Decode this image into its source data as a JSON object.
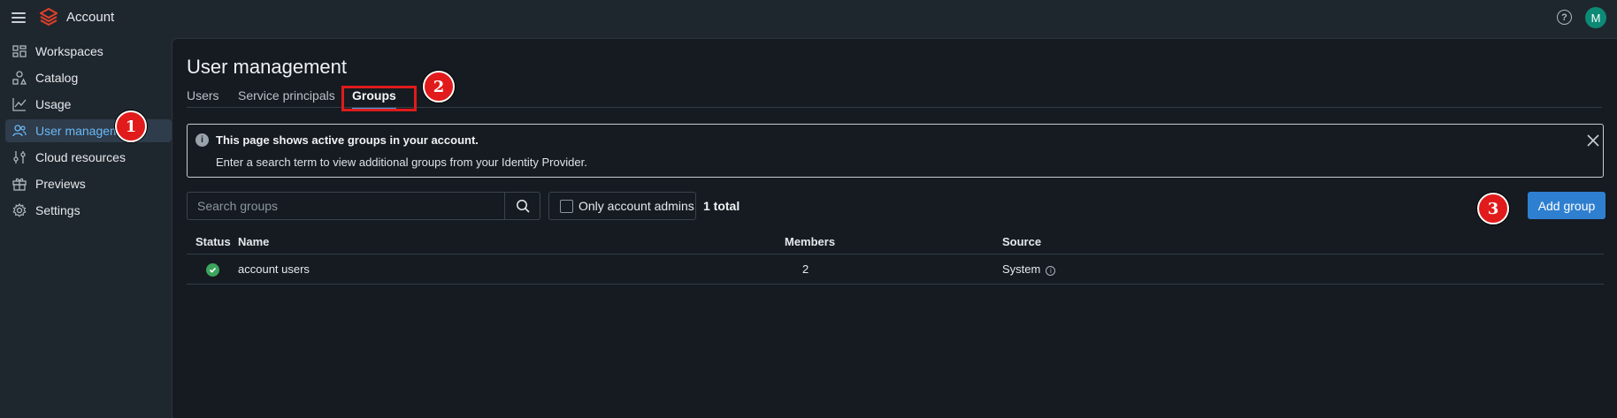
{
  "header": {
    "app_title": "Account",
    "avatar_initial": "M",
    "help_glyph": "?",
    "icons": [
      "menu-icon",
      "databricks-logo",
      "help-icon"
    ]
  },
  "sidebar": {
    "items": [
      {
        "label": "Workspaces",
        "icon": "workspaces-icon",
        "active": false
      },
      {
        "label": "Catalog",
        "icon": "catalog-icon",
        "active": false
      },
      {
        "label": "Usage",
        "icon": "usage-icon",
        "active": false
      },
      {
        "label": "User management",
        "icon": "users-icon",
        "active": true
      },
      {
        "label": "Cloud resources",
        "icon": "sliders-icon",
        "active": false
      },
      {
        "label": "Previews",
        "icon": "gift-icon",
        "active": false
      },
      {
        "label": "Settings",
        "icon": "gear-icon",
        "active": false
      }
    ]
  },
  "main": {
    "title": "User management",
    "tabs": [
      {
        "label": "Users",
        "active": false
      },
      {
        "label": "Service principals",
        "active": false
      },
      {
        "label": "Groups",
        "active": true
      }
    ],
    "banner": {
      "title": "This page shows active groups in your account.",
      "text": "Enter a search term to view additional groups from your Identity Provider."
    },
    "search": {
      "placeholder": "Search groups"
    },
    "filter": {
      "label": "Only account admins",
      "checked": false
    },
    "total": "1 total",
    "add_button": "Add group",
    "table": {
      "columns": [
        "Status",
        "Name",
        "Members",
        "Source"
      ],
      "rows": [
        {
          "status": "active",
          "name": "account users",
          "members": "2",
          "source": "System"
        }
      ]
    }
  },
  "annotations": {
    "markers": [
      "1",
      "2",
      "3"
    ],
    "marker_color": "#e11b1b"
  },
  "colors": {
    "accent": "#2f7fd0",
    "active_nav": "#6cb8f5",
    "status_ok": "#3ba55c",
    "avatar": "#0d8a76"
  }
}
